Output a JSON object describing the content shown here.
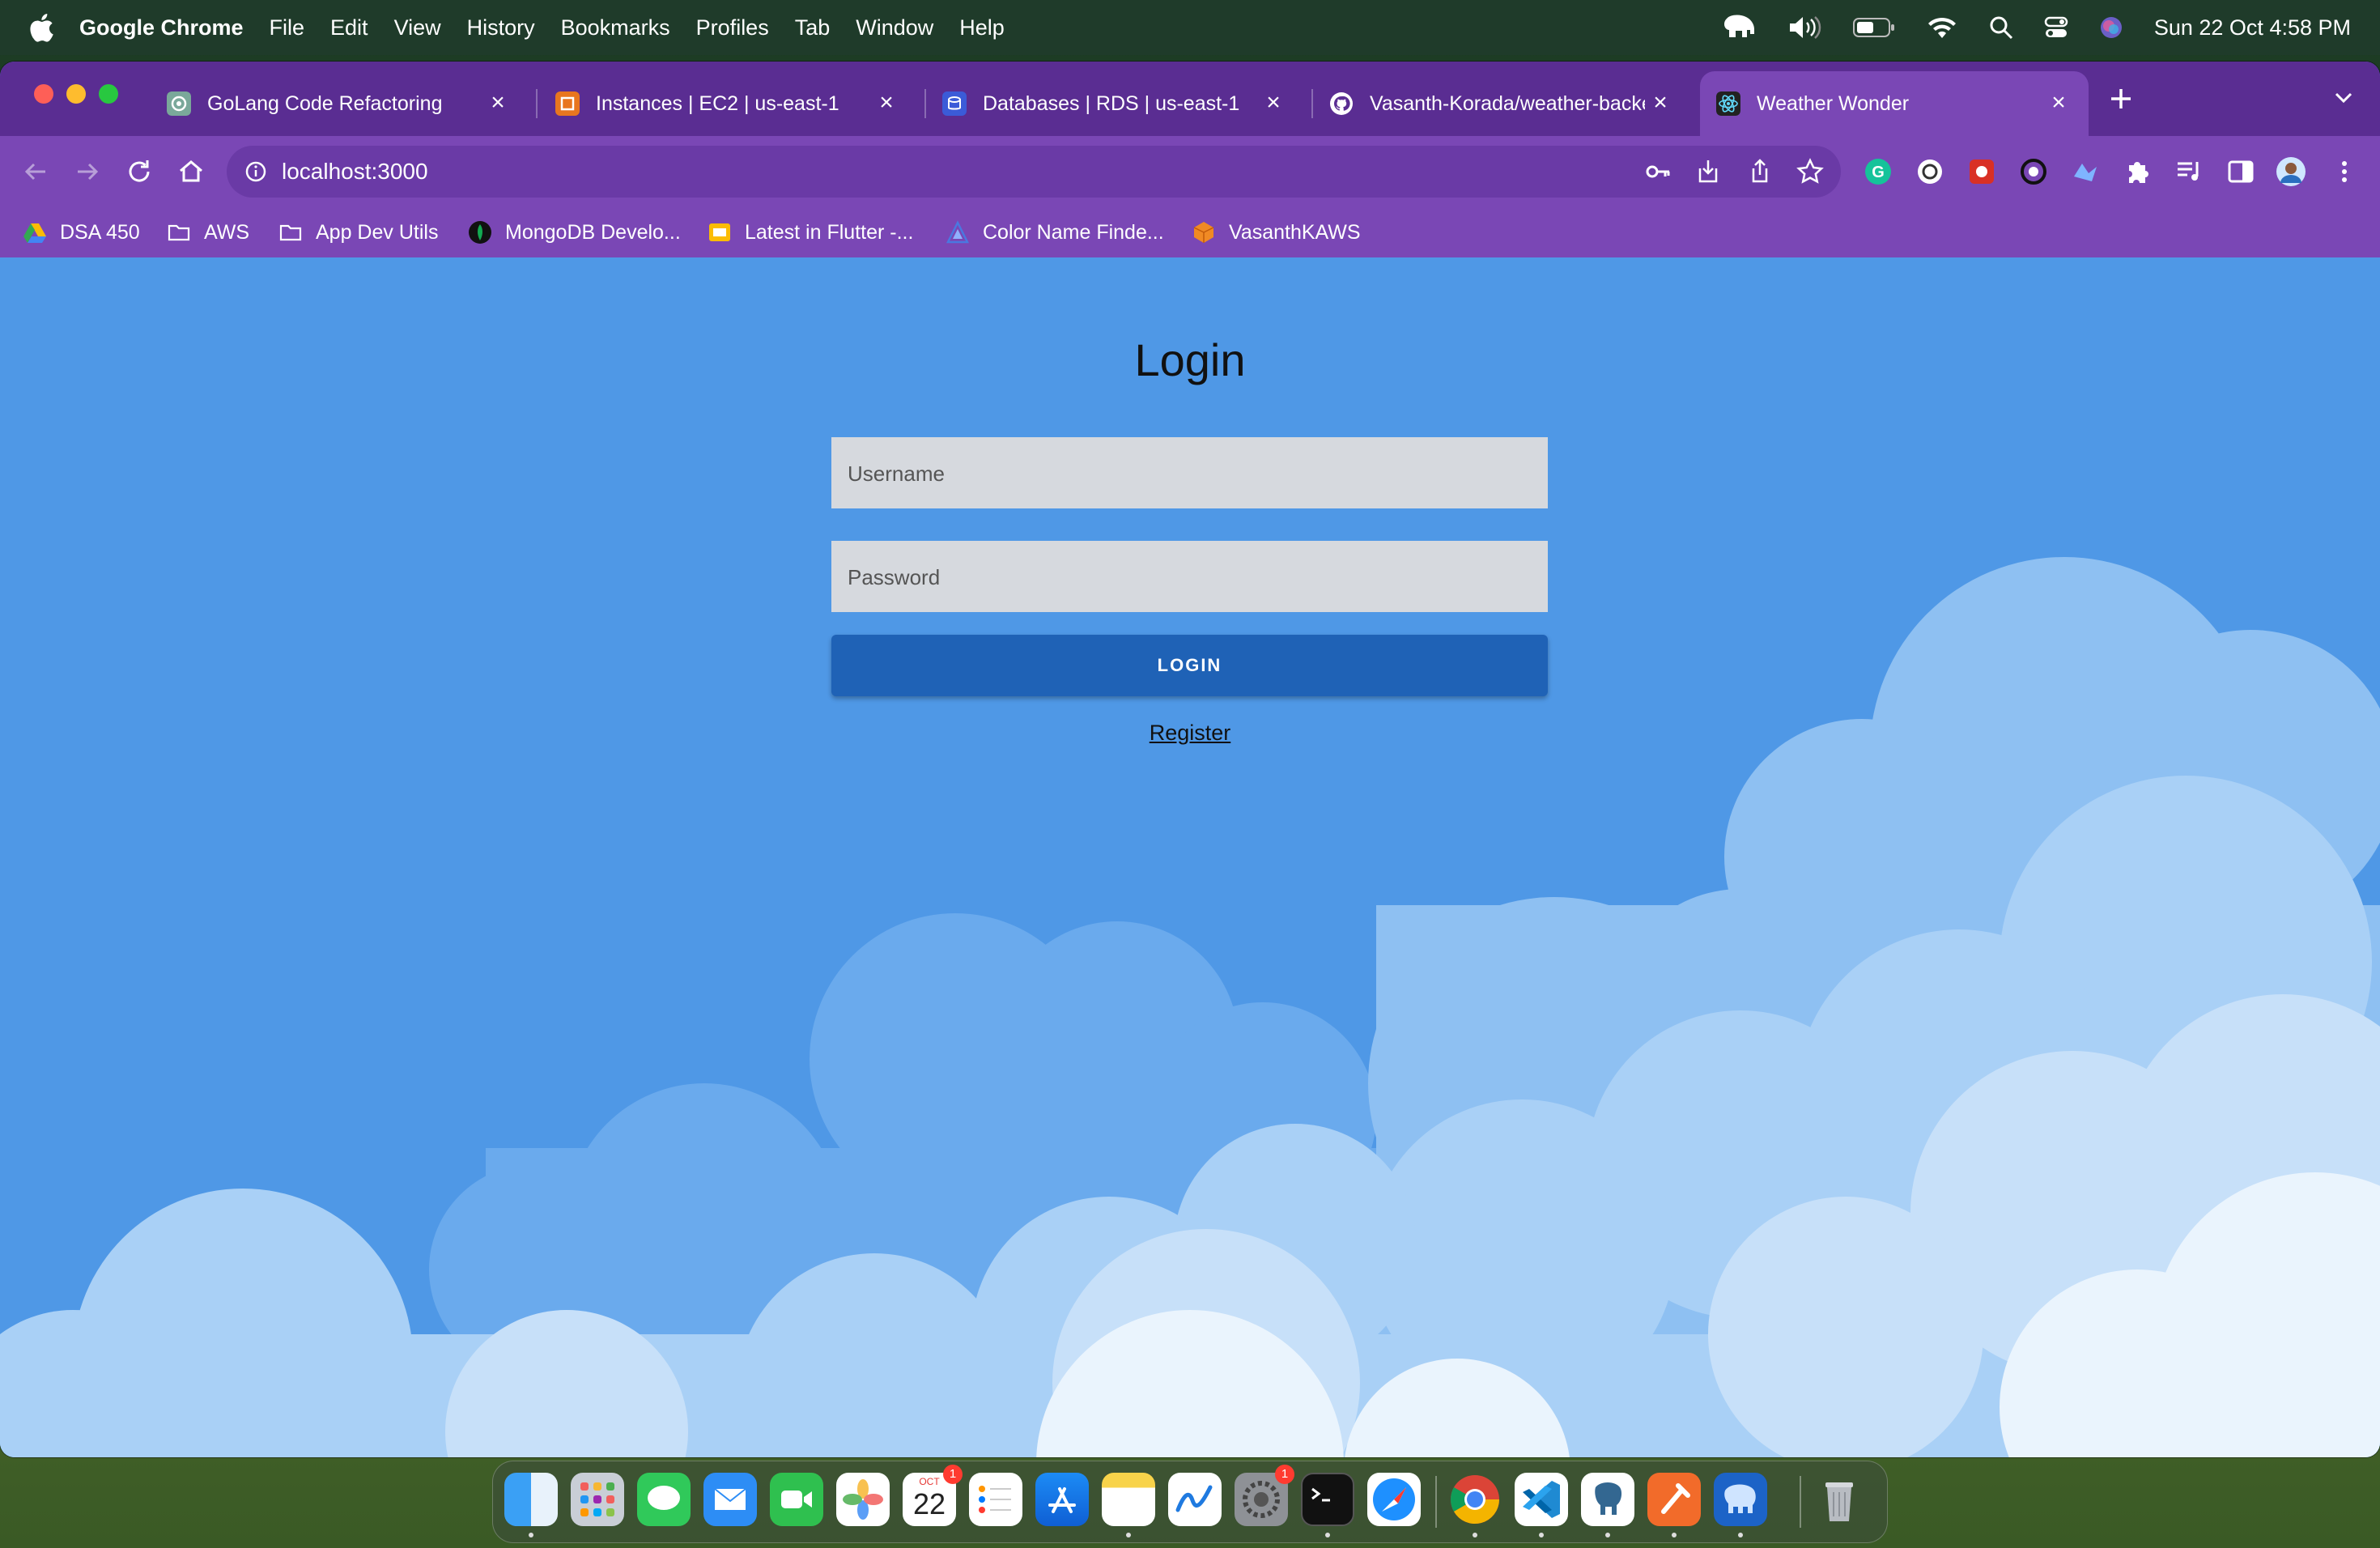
{
  "menubar": {
    "app_name": "Google Chrome",
    "menus": [
      "File",
      "Edit",
      "View",
      "History",
      "Bookmarks",
      "Profiles",
      "Tab",
      "Window",
      "Help"
    ],
    "clock": "Sun 22 Oct  4:58 PM",
    "status_icons": [
      "elephant-icon",
      "volume-icon",
      "battery-icon",
      "wifi-icon",
      "search-icon",
      "control-center-icon",
      "siri-icon"
    ]
  },
  "tabs": [
    {
      "title": "GoLang Code Refactoring",
      "icon": "chatgpt-icon",
      "active": false
    },
    {
      "title": "Instances | EC2 | us-east-1",
      "icon": "aws-ec2-icon",
      "active": false
    },
    {
      "title": "Databases | RDS | us-east-1",
      "icon": "aws-rds-icon",
      "active": false
    },
    {
      "title": "Vasanth-Korada/weather-backend",
      "icon": "github-icon",
      "active": false
    },
    {
      "title": "Weather Wonder",
      "icon": "react-icon",
      "active": true
    }
  ],
  "address_bar": {
    "url": "localhost:3000"
  },
  "bookmarks": [
    {
      "label": "DSA 450",
      "icon": "drive-icon"
    },
    {
      "label": "AWS",
      "icon": "folder-icon"
    },
    {
      "label": "App Dev Utils",
      "icon": "folder-icon"
    },
    {
      "label": "MongoDB Develo...",
      "icon": "mongodb-icon"
    },
    {
      "label": "Latest in Flutter -...",
      "icon": "slides-icon"
    },
    {
      "label": "Color Name Finde...",
      "icon": "color-finder-icon"
    },
    {
      "label": "VasanthKAWS",
      "icon": "aws-cube-icon"
    }
  ],
  "login": {
    "title": "Login",
    "username_placeholder": "Username",
    "password_placeholder": "Password",
    "button_label": "LOGIN",
    "register_link": "Register"
  },
  "dock": {
    "calendar_month": "OCT",
    "calendar_day": "22",
    "calendar_badge": "1",
    "settings_badge": "1"
  },
  "colors": {
    "page_background": "#4f98e6",
    "login_button": "#1f62b6",
    "input_background": "#d6d9de",
    "tab_strip": "#5a2d92",
    "toolbar": "#7a47b5"
  }
}
